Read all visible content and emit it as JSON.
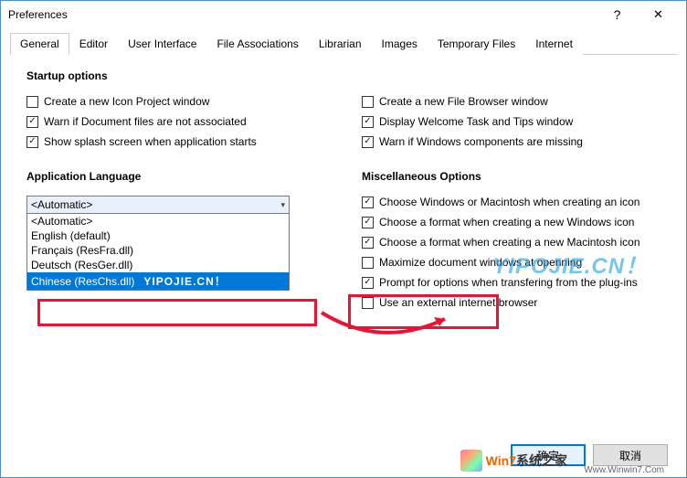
{
  "window": {
    "title": "Preferences"
  },
  "tabs": {
    "general": "General",
    "editor": "Editor",
    "ui": "User Interface",
    "file_assoc": "File Associations",
    "librarian": "Librarian",
    "images": "Images",
    "temp": "Temporary Files",
    "internet": "Internet"
  },
  "startup": {
    "heading": "Startup options",
    "create_icon_proj": "Create a new Icon Project window",
    "warn_doc_assoc": "Warn if Document files are not associated",
    "show_splash": "Show splash screen when application starts",
    "create_file_browser": "Create a new File Browser window",
    "display_welcome": "Display Welcome Task and Tips window",
    "warn_win_components": "Warn if Windows components are missing"
  },
  "language": {
    "heading": "Application Language",
    "current": "<Automatic>",
    "options": {
      "auto": "<Automatic>",
      "en": "English (default)",
      "fr": "Français (ResFra.dll)",
      "de": "Deutsch (ResGer.dll)",
      "zh": "Chinese (ResChs.dll)"
    }
  },
  "misc": {
    "heading": "Miscellaneous Options",
    "choose_win_mac": "Choose Windows or Macintosh when creating an icon",
    "choose_fmt_win": "Choose a format when creating a new Windows icon",
    "choose_fmt_mac": "Choose a format when creating a new Macintosh icon",
    "maximize_doc": "Maximize document windows at openning",
    "prompt_transfer": "Prompt for options when transfering from the plug-ins",
    "external_browser": "Use an external internet browser"
  },
  "buttons": {
    "ok": "确定",
    "cancel": "取消"
  },
  "watermark": {
    "main": "YIPOJIE.CN！",
    "inline": "YIPOJIE.CN！"
  },
  "brand": {
    "text1": "Win7",
    "text2": "系统之家",
    "sub": "Www.Winwin7.Com"
  }
}
